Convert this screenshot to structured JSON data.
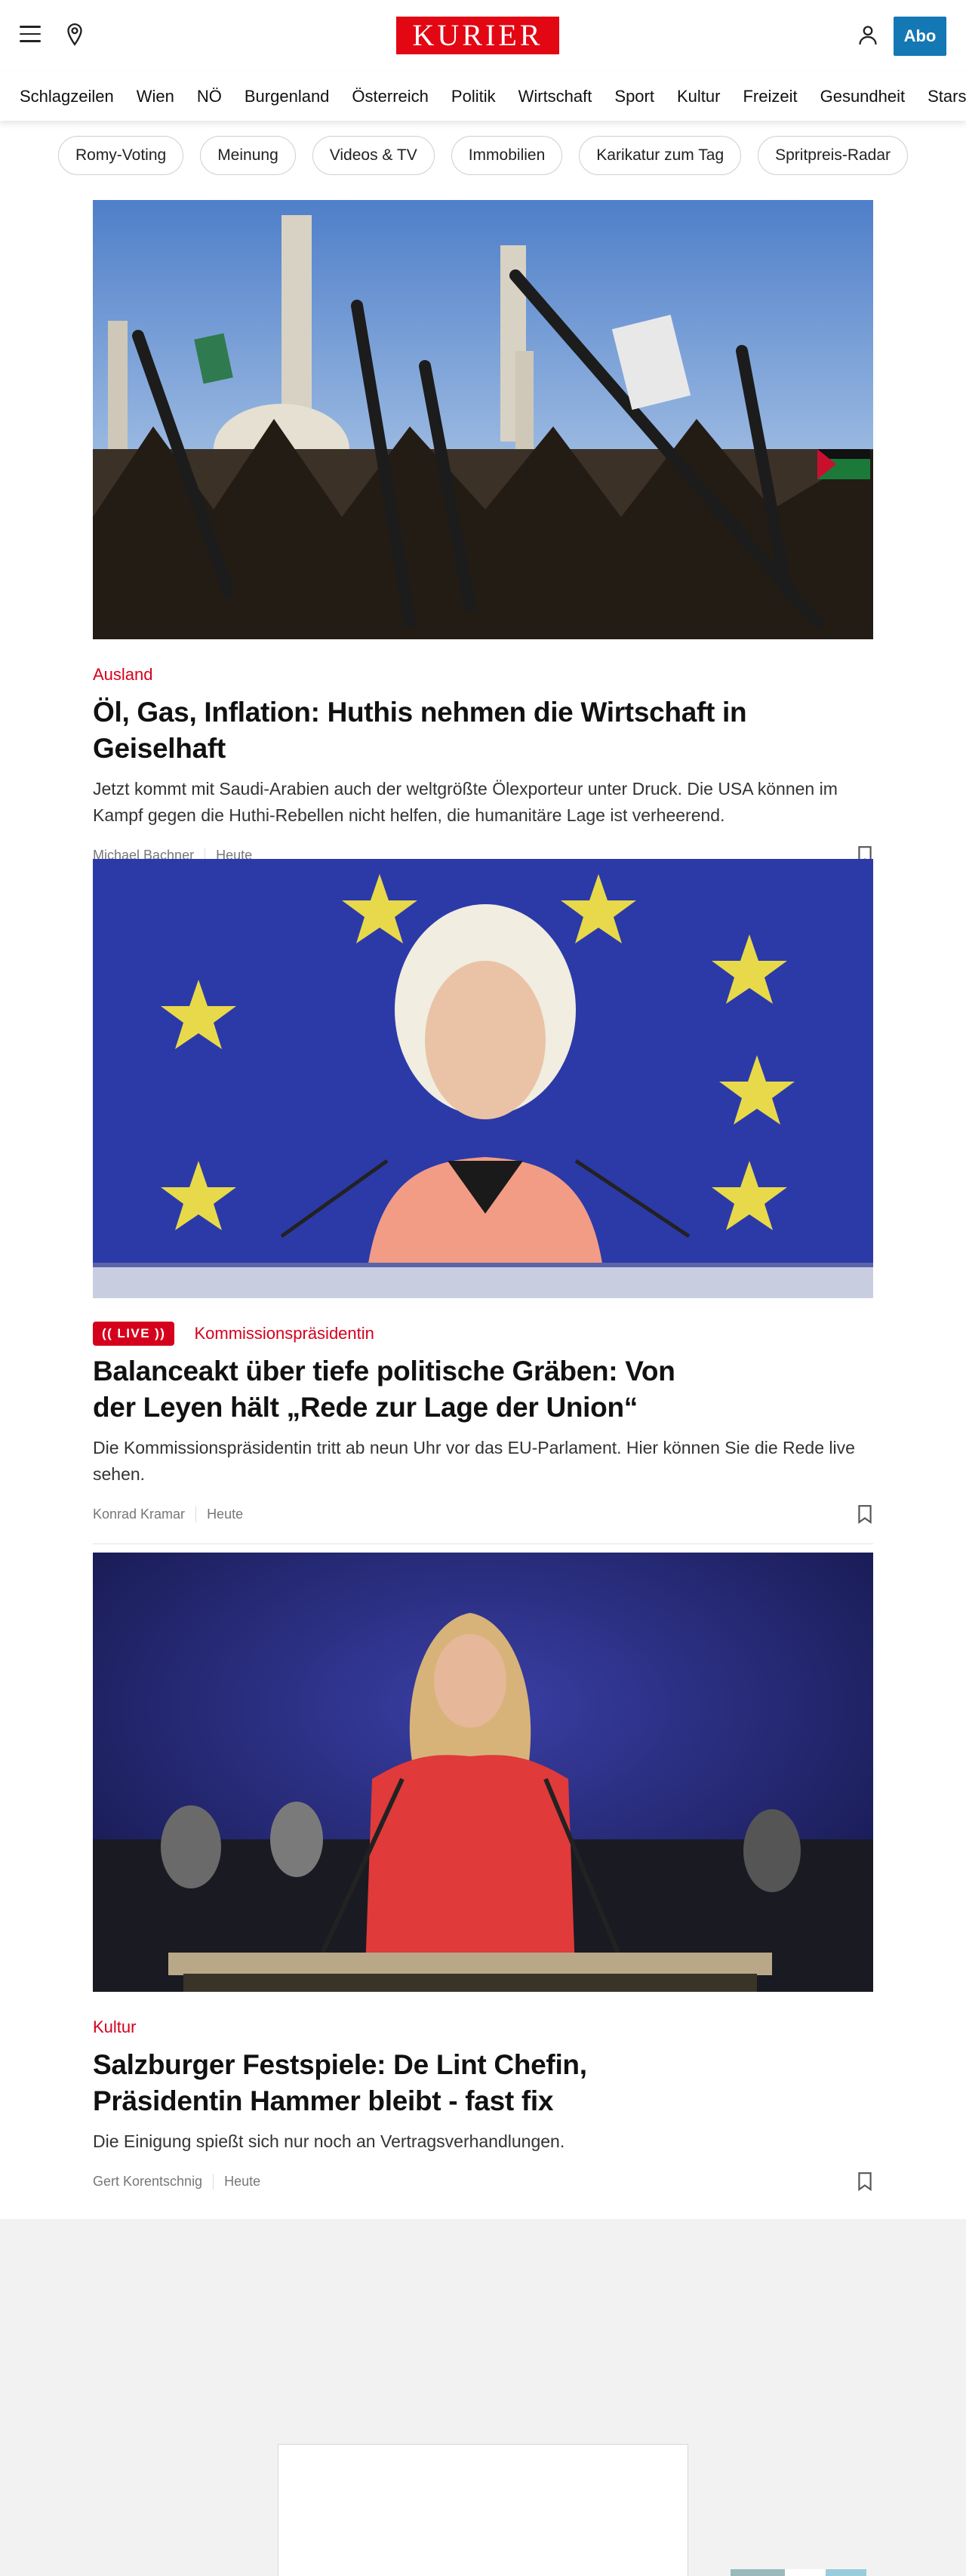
{
  "header": {
    "logo": "KURIER",
    "abo_label": "Abo",
    "icons": {
      "menu": "menu-icon",
      "location": "location-pin-icon",
      "user": "user-icon"
    }
  },
  "nav": {
    "items": [
      "Schlagzeilen",
      "Wien",
      "NÖ",
      "Burgenland",
      "Österreich",
      "Politik",
      "Wirtschaft",
      "Sport",
      "Kultur",
      "Freizeit",
      "Gesundheit",
      "Stars"
    ]
  },
  "pills": [
    "Romy-Voting",
    "Meinung",
    "Videos & TV",
    "Immobilien",
    "Karikatur zum Tag",
    "Spritpreis-Radar"
  ],
  "articles": [
    {
      "kicker": "Ausland",
      "title": "Öl, Gas, Inflation: Huthis nehmen die Wirtschaft in Geiselhaft",
      "teaser": "Jetzt kommt mit Saudi-Arabien auch der weltgrößte Ölexporteur unter Druck. Die USA können im Kampf gegen die Huthi-Rebellen nicht helfen, die humanitäre Lage ist verheerend.",
      "author": "Michael Bachner",
      "date": "Heute"
    },
    {
      "live_label": "LIVE",
      "kicker": "Kommissionspräsidentin",
      "title_line1": "Balanceakt über tiefe politische Gräben: Von",
      "title_line2": "der Leyen hält „Rede zur Lage der Union“",
      "teaser": "Die Kommissionspräsidentin tritt ab neun Uhr vor das EU-Parlament. Hier können Sie die Rede live sehen.",
      "author": "Konrad Kramar",
      "date": "Heute"
    },
    {
      "kicker": "Kultur",
      "title_line1": "Salzburger Festspiele: De Lint Chefin,",
      "title_line2": "Präsidentin Hammer bleibt - fast fix",
      "teaser": "Die Einigung spießt sich nur noch an Vertragsverhandlungen.",
      "author": "Gert Korentschnig",
      "date": "Heute"
    }
  ],
  "colors": {
    "brand_red": "#e30613",
    "kicker_red": "#d5001c",
    "abo_blue": "#1478b4"
  }
}
